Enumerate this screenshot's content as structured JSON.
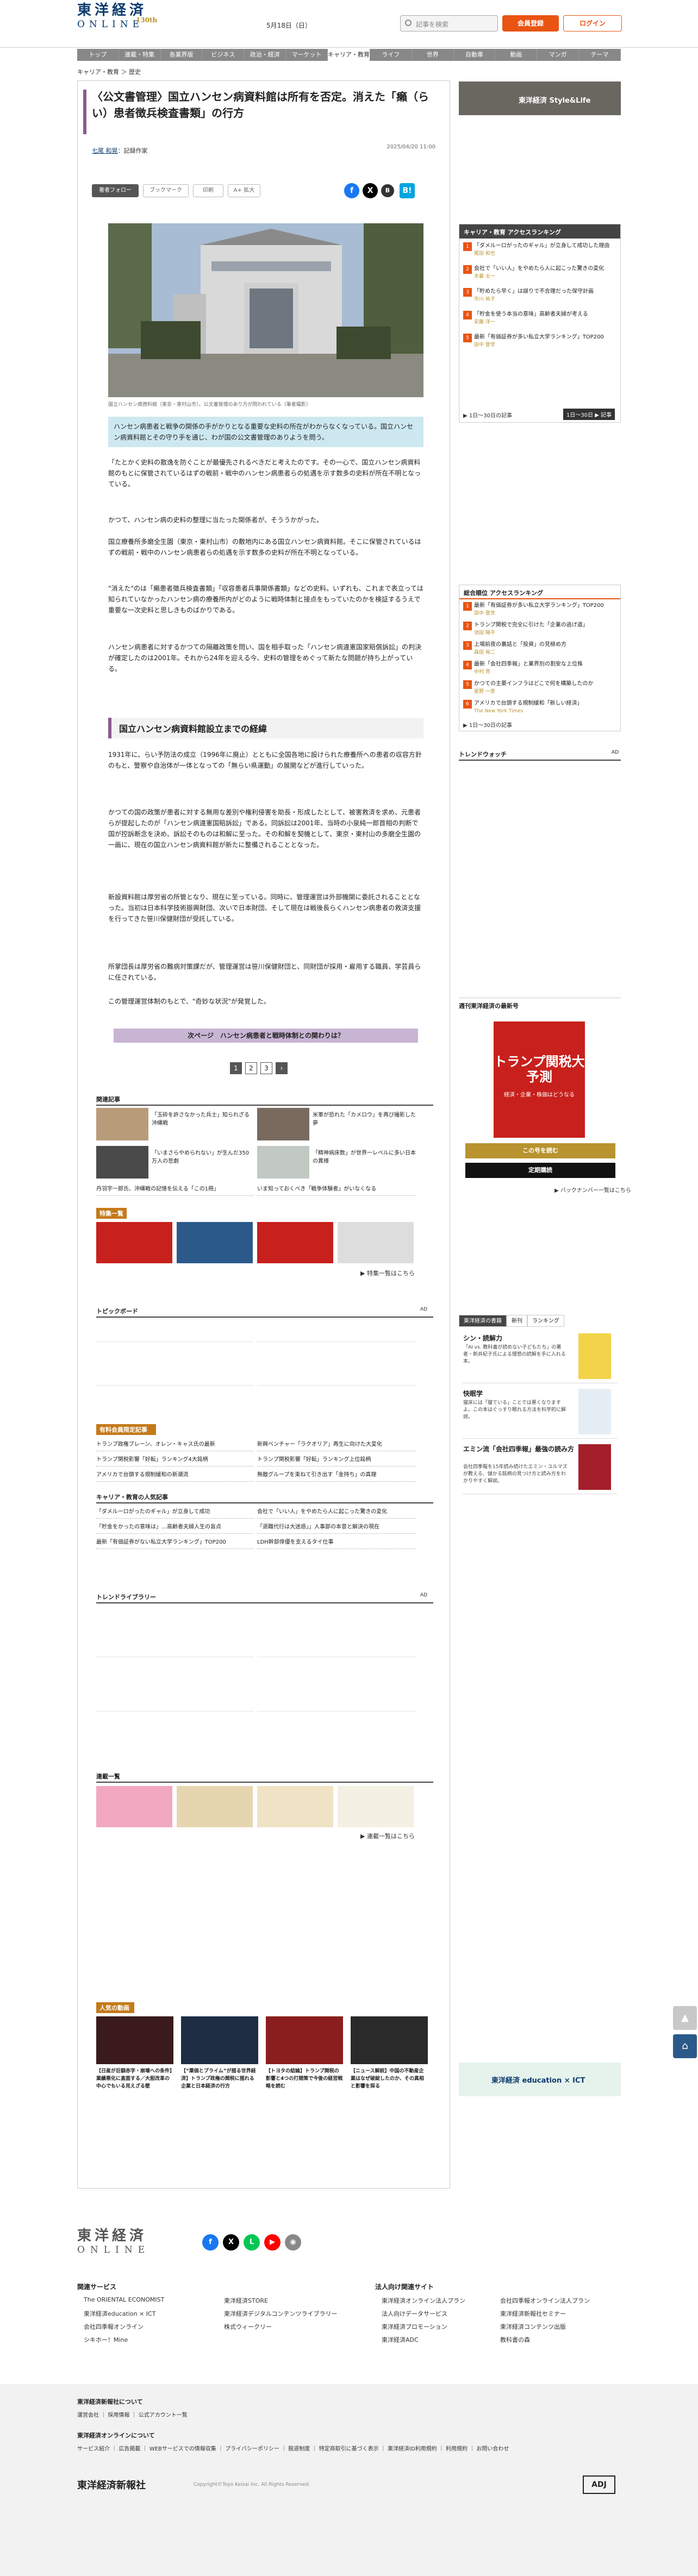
{
  "header": {
    "logo_ja": "東洋経済",
    "logo_en": "ONLINE",
    "logo_anniversary": "130th",
    "date": "5月18日（日）",
    "search_placeholder": "記事を検索",
    "member_button": "会員登録",
    "login_button": "ログイン"
  },
  "nav": [
    "トップ",
    "連載・特集",
    "各業界版",
    "ビジネス",
    "政治・経済",
    "マーケット",
    "キャリア・教育",
    "ライフ",
    "世界",
    "自動車",
    "動画",
    "マンガ",
    "テーマ"
  ],
  "nav_active": "キャリア・教育",
  "breadcrumb": "キャリア・教育 ＞ 歴史",
  "article": {
    "title": "〈公文書管理〉国立ハンセン病資料館は所有を否定。消えた「癩（らい）患者徴兵検査書類」の行方",
    "author_name": "七尾 和晃",
    "author_role": "：記録作家",
    "pubdate": "2025/04/20 11:00",
    "follow_button": "著者フォロー",
    "bookmark_button": "ブックマーク",
    "print_button": "印刷",
    "fontsize_button": "A+ 拡大",
    "caption": "国立ハンセン病資料館（東京・東村山市）。公文書管理のあり方が問われている（筆者撮影）",
    "lead": "ハンセン病患者と戦争の関係の手がかりとなる重要な史料の所在がわからなくなっている。国立ハンセン病資料館とその守り手を通じ、わが国の公文書管理のありようを問う。",
    "paragraphs": [
      "「たとかく史料の散逸を防ぐことが最優先されるべきだと考えたのです。その一心で、国立ハンセン病資料館のもとに保管されているはずの戦前・戦中のハンセン病患者らの処遇を示す数多の史料が所在不明となっている。",
      "かつて、ハンセン病の史料の整理に当たった関係者が、そううかがった。",
      "国立療養所多磨全生園（東京・東村山市）の敷地内にある国立ハンセン病資料館。そこに保管されているはずの戦前・戦中のハンセン病患者らの処遇を示す数多の史料が所在不明となっている。",
      "\"消えた\"のは「癩患者徴兵検査書類」「収容患者兵事関係書類」などの史料。いずれも、これまで表立っては知られていなかったハンセン病の療養所内がどのように戦時体制と接点をもっていたのかを検証するうえで重要な一次史料と思しきものばかりである。",
      "ハンセン病患者に対するかつての隔離政策を問い、国を相手取った「ハンセン病違憲国家賠償訴訟」の判決が確定したのは2001年。それから24年を迎える今、史料の管理をめぐって新たな問題が持ち上がっている。"
    ],
    "section_heading": "国立ハンセン病資料館設立までの経緯",
    "paragraphs2": [
      "1931年に、らい予防法の成立（1996年に廃止）とともに全国各地に設けられた療養所への患者の収容方針のもと、警察や自治体が一体となっての「無らい県運動」の展開などが進行していった。",
      "かつての国の政策が患者に対する無用な差別や権利侵害を助長・形成したとして、被害救済を求め、元患者らが提起したのが「ハンセン病違憲国賠訴訟」である。同訴訟は2001年、当時の小泉純一郎首相の判断で国が控訴断念を決め、訴訟そのものは和解に至った。その和解を契機として、東京・東村山の多磨全生園の一画に、現在の国立ハンセン病資料館が新たに整備されることとなった。",
      "新設資料館は厚労省の所管となり、現在に至っている。同時に、管理運営は外部機関に委託されることとなった。当初は日本科学技術振興財団、次いで日本財団、そして現在は戦後長らくハンセン病患者の救済支援を行ってきた笹川保健財団が受託している。",
      "所掌団長は厚労省の難病対策課だが、管理運営は笹川保健財団と、同財団が採用・雇用する職員、学芸員らに任されている。",
      "この管理運営体制のもとで、\"奇妙な状況\"が発覚した。"
    ],
    "next_page": "次ページ　ハンセン病患者と戦時体制との関わりは？",
    "pages": [
      "1",
      "2",
      "3"
    ]
  },
  "related": {
    "label": "関連記事",
    "items": [
      "「玉砕を許さなかった兵士」知られざる沖縄戦",
      "米軍が恐れた「カメロウ」を再び撮影した夢",
      "「いまさらやめられない」が生んだ350万人の悲劇",
      "「精神病床数」が世界一レベルに多い日本の異様"
    ],
    "lines": [
      "丹羽宇一郎氏、沖縄戦の記憶を伝える「この1冊」",
      "いま知っておくべき「戦争体験者」がいなくなる"
    ]
  },
  "special": {
    "label": "特集一覧",
    "more": "▶ 特集一覧はこちら"
  },
  "topics_label": "トピックボード",
  "ad_label": "AD",
  "premium": {
    "label": "有料会員限定記事",
    "items": [
      "トランプ政権ブレーン、オレン・キャス氏の最新",
      "新興ベンチャー「ラクオリア」再生に向けた大変化",
      "トランプ関税影響「好転」ランキング4大銘柄",
      "トランプ関税影響「好転」ランキング上位銘柄",
      "アメリカで台頭する規制緩和の新潮流",
      "無敵グループを束ねて引き出す「金持ち」の真理"
    ]
  },
  "career": {
    "label": "キャリア・教育の人気記事",
    "items": [
      "「ダメルーロがったのギャル」が立身して成功",
      "会社で「いい人」をやめたら人に起こった驚きの変化",
      "「貯金をかったの意味は」…高齢者夫婦人生の盲点",
      "「退職代行は大迷惑」」人事部の本音と解決の現在",
      "最新「有価証券がない私立大学ランキング」TOP200",
      "LDH幹部俳優を支えるタイ仕事"
    ]
  },
  "trend_label": "トレンドライブラリー",
  "serial": {
    "label": "連載一覧",
    "more": "▶ 連載一覧はこちら"
  },
  "video": {
    "label": "人気の動画",
    "items": [
      "【日産が巨額赤字・崩壊への条件】業績悪化に直面する／大胆改革の中心でもいる見えざる壁",
      "【“薬価とプライム”が揺る世界経済】トランプ政権の関税に揺れる企業と日本経済の行方",
      "【トヨタの結論】トランプ関税の影響と4つの打開策で今後の経営戦略を読む",
      "【ニュース解説】中国の不動産企業はなぜ破綻したのか、その真相と影響を探る"
    ]
  },
  "right": {
    "banner_top": "東洋経済 Style&Life",
    "ranking_label": "キャリア・教育 アクセスランキング",
    "ranking": [
      {
        "title": "「ダメルーロがったのギャル」が立身して成功した理由",
        "name": "尾田 和也"
      },
      {
        "title": "会社で「いい人」をやめたら人に起こった驚きの変化",
        "name": "木暮 太一"
      },
      {
        "title": "「貯めたら早く」は誤りで不合理だった保守計画",
        "name": "市川 祐子"
      },
      {
        "title": "「貯金を使う本当の意味」高齢者夫婦が考える",
        "name": "安藤 洋一"
      },
      {
        "title": "最新「有価証券が多い私立大学ランキング」TOP200",
        "name": "田中 登世"
      }
    ],
    "ranking_more": "▶ 1日〜30日の記事",
    "ranking_button": "1日〜30日 ▶ 記事",
    "overall_label": "総合順位 アクセスランキング",
    "overall": [
      {
        "title": "最新「有価証券が多い私立大学ランキング」TOP200",
        "name": "田中 登世"
      },
      {
        "title": "トランプ関税で完全に引けた「企業の逃げ道」",
        "name": "池田 陽平"
      },
      {
        "title": "上場前夜の裏話と「投資」の見極め方",
        "name": "森田 裕二"
      },
      {
        "title": "最新「会社四季報」と業界別の割安な上位株",
        "name": "中村 亮"
      },
      {
        "title": "かつての主要インフラはどこで何を構築したのか",
        "name": "星野 一彦"
      },
      {
        "title": "アメリカで台頭する規制緩和「新しい経済」",
        "name": "The New York Times"
      }
    ],
    "overall_more": "▶ 1日〜30日の記事",
    "trendwatch_label": "トレンドウォッチ",
    "book_label": "週刊東洋経済の最新号",
    "book_title": "トランプ関税大予測",
    "book_sub": "経済・企業・株価はどうなる",
    "book_btn1": "この号を読む",
    "book_btn2": "定期購読",
    "book_more": "▶ バックナンバー一覧はこちら",
    "tabs": [
      "東洋経済の書籍",
      "新刊",
      "ランキング"
    ],
    "books": [
      {
        "title": "シン・読解力",
        "desc": "「AI vs. 教科書が読めない子どもたち」の著者・新井紀子氏による理想の読解を手に入れる本。"
      },
      {
        "title": "快眠学",
        "desc": "寝床には「寝ている」ことでは悪くなりますよ。この本はぐっすり眠れる方法を科学的に解説。"
      },
      {
        "title": "エミン流「会社四季報」最強の読み方",
        "desc": "会社四季報を15年読み続けたエミン・ユルマズが教える、儲かる銘柄の見つけ方と読み方をわかりやすく解説。"
      }
    ],
    "edu_banner": "東洋経済 education × ICT"
  },
  "footer": {
    "logo_ja": "東洋経済",
    "logo_en": "ONLINE",
    "related_services": "関連サービス",
    "services": [
      "The ORIENTAL ECONOMIST",
      "東洋経済STORE",
      "東洋経済education × ICT",
      "東洋経済デジタルコンテンツライブラリー",
      "会社四季報オンライン",
      "株式ウィークリー",
      "シキホー！Mine"
    ],
    "corp_label": "法人向け関連サイト",
    "corp": [
      "東洋経済オンライン法人プラン",
      "会社四季報オンライン法人プラン",
      "法人向けデータサービス",
      "東洋経済新報社セミナー",
      "東洋経済プロモーション",
      "東洋経済コンテンツ出版",
      "東洋経済ADC",
      "教科書の森"
    ],
    "company_label": "東洋経済新報社について",
    "company_links": "運営会社 ｜ 採用情報 ｜ 公式アカウント一覧",
    "about_label": "東洋経済オンラインについて",
    "about_links": "サービス紹介 ｜ 広告掲載 ｜ WEBサービスでの情報収集 ｜ プライバシーポリシー ｜ 脱退制度 ｜ 特定商取引に基づく表示 ｜ 東洋経済ID利用規約 ｜ 利用規約 ｜ お問い合わせ",
    "publisher": "東洋経済新報社",
    "copyright": "Copyright©Toyo Keizai Inc. All Rights Reserved.",
    "jaro": "ADJ"
  }
}
